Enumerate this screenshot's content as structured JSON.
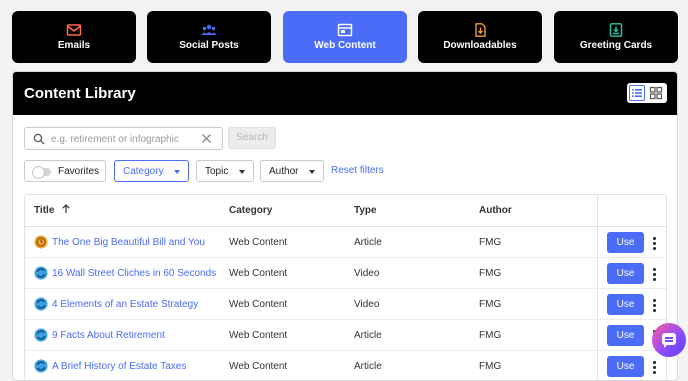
{
  "tabs": [
    {
      "label": "Emails",
      "icon": "envelope-icon",
      "active": false
    },
    {
      "label": "Social Posts",
      "icon": "people-icon",
      "active": false
    },
    {
      "label": "Web Content",
      "icon": "browser-window-icon",
      "active": true
    },
    {
      "label": "Downloadables",
      "icon": "document-download-icon",
      "active": false
    },
    {
      "label": "Greeting Cards",
      "icon": "card-download-icon",
      "active": false
    }
  ],
  "colors": {
    "accent": "#4a6cf7",
    "header_bg": "#000000",
    "email_icon": "#ff6b4a",
    "social_icon": "#4a6cf7",
    "download_icon": "#f0a030",
    "greeting_icon": "#2ec4a6"
  },
  "library": {
    "title": "Content Library",
    "view_modes": [
      "list-view-icon",
      "grid-view-icon"
    ],
    "search": {
      "placeholder": "e.g. retirement or infographic",
      "value": "",
      "button": "Search"
    },
    "filters": {
      "favorites": "Favorites",
      "category": "Category",
      "topic": "Topic",
      "author": "Author",
      "reset": "Reset filters"
    },
    "columns": {
      "title": "Title",
      "category": "Category",
      "type": "Type",
      "author": "Author"
    },
    "rows": [
      {
        "title": "The One Big Beautiful Bill and You",
        "category": "Web Content",
        "type": "Article",
        "author": "FMG",
        "action": "Use",
        "icon": "clock-coin-icon"
      },
      {
        "title": "16 Wall Street Cliches in 60 Seconds",
        "category": "Web Content",
        "type": "Video",
        "author": "FMG",
        "action": "Use",
        "icon": "globe-cycle-icon"
      },
      {
        "title": "4 Elements of an Estate Strategy",
        "category": "Web Content",
        "type": "Video",
        "author": "FMG",
        "action": "Use",
        "icon": "globe-cycle-icon"
      },
      {
        "title": "9 Facts About Retirement",
        "category": "Web Content",
        "type": "Article",
        "author": "FMG",
        "action": "Use",
        "icon": "globe-cycle-icon"
      },
      {
        "title": "A Brief History of Estate Taxes",
        "category": "Web Content",
        "type": "Article",
        "author": "FMG",
        "action": "Use",
        "icon": "globe-cycle-icon"
      }
    ]
  },
  "chat": {
    "icon": "chat-bubble-icon"
  }
}
